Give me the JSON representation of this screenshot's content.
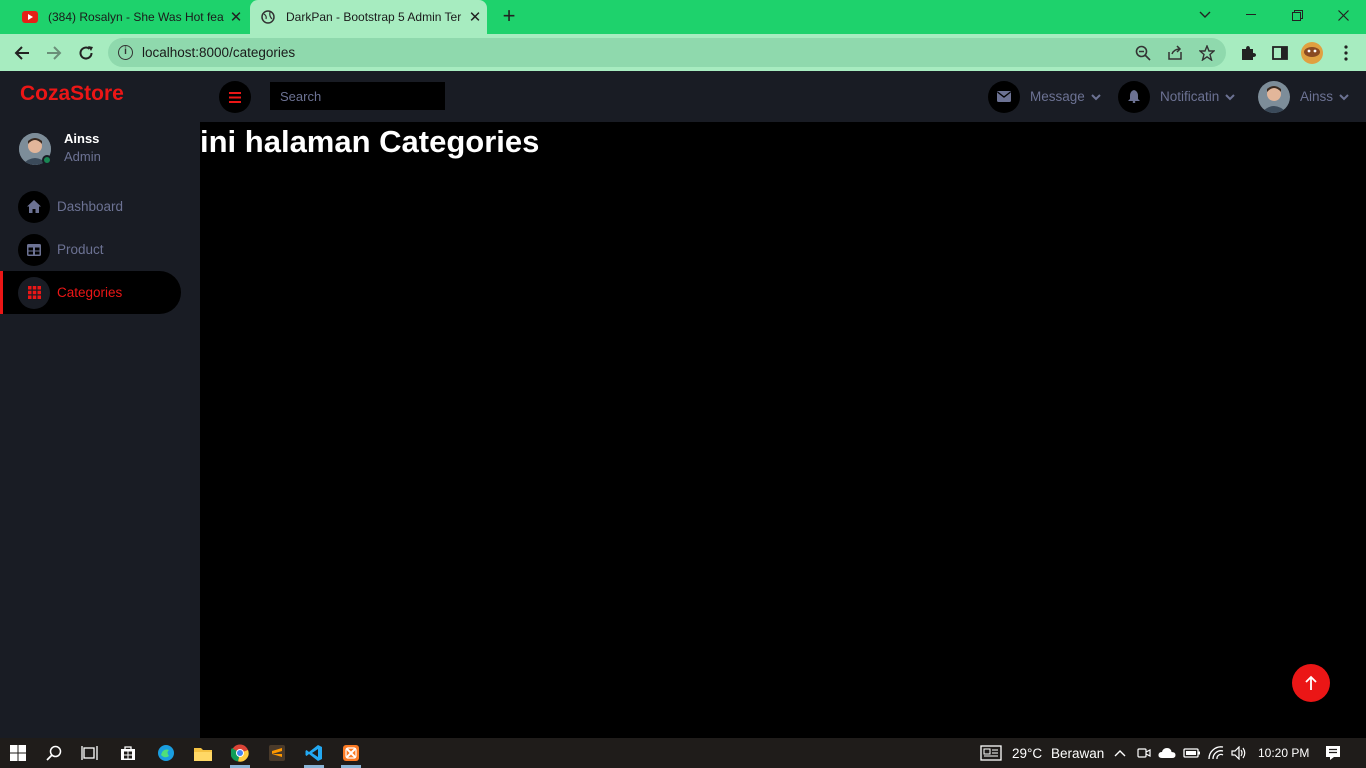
{
  "browser": {
    "tabs": [
      {
        "title": "(384) Rosalyn - She Was Hot feat",
        "icon": "youtube-icon",
        "active": false
      },
      {
        "title": "DarkPan - Bootstrap 5 Admin Ter",
        "icon": "globe-icon",
        "active": true
      }
    ],
    "url": "localhost:8000/categories"
  },
  "app": {
    "brand": "CozaStore",
    "user": {
      "name": "Ainss",
      "role": "Admin"
    },
    "nav": [
      {
        "label": "Dashboard",
        "icon": "home-icon",
        "active": false
      },
      {
        "label": "Product",
        "icon": "table-icon",
        "active": false
      },
      {
        "label": "Categories",
        "icon": "grid-icon",
        "active": true
      }
    ],
    "search_placeholder": "Search",
    "topbar": {
      "message_label": "Message",
      "notification_label": "Notificatin",
      "profile_label": "Ainss"
    },
    "page_heading": "ini halaman Categories",
    "colors": {
      "accent": "#eb1616",
      "panel": "#191c24",
      "muted": "#6c7293",
      "browser_green": "#1ed26c"
    }
  },
  "taskbar": {
    "weather_temp": "29°C",
    "weather_text": "Berawan",
    "clock": "10:20 PM"
  }
}
